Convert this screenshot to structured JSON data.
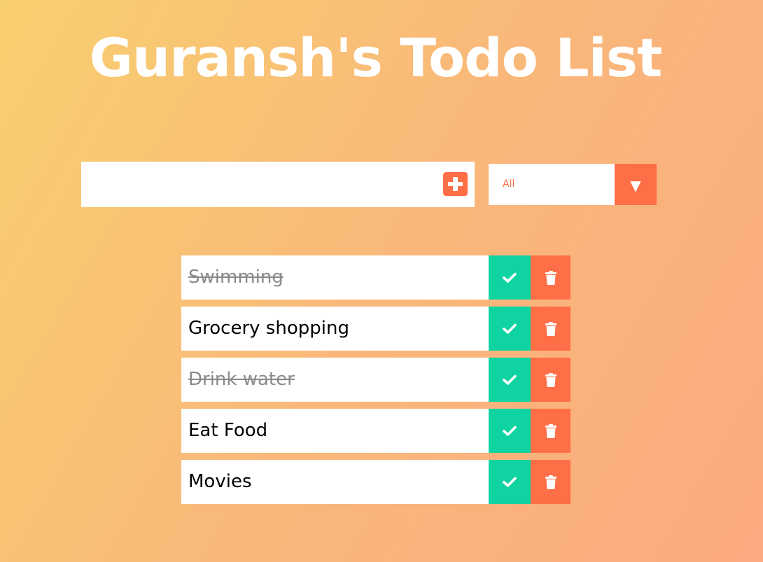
{
  "header": {
    "title": "Guransh's Todo List"
  },
  "input": {
    "value": "",
    "placeholder": ""
  },
  "filter": {
    "selected": "All",
    "arrow_icon": "triangle-down-icon"
  },
  "todos": [
    {
      "text": "Swimming",
      "completed": true
    },
    {
      "text": "Grocery shopping",
      "completed": false
    },
    {
      "text": "Drink water",
      "completed": true
    },
    {
      "text": "Eat Food",
      "completed": false
    },
    {
      "text": "Movies",
      "completed": false
    }
  ],
  "icons": {
    "add": "plus-square-icon",
    "complete": "check-icon",
    "delete": "trash-icon"
  },
  "colors": {
    "accent": "#ff6f47",
    "complete": "#10d3a2",
    "completed_text": "#8a8a8a"
  }
}
